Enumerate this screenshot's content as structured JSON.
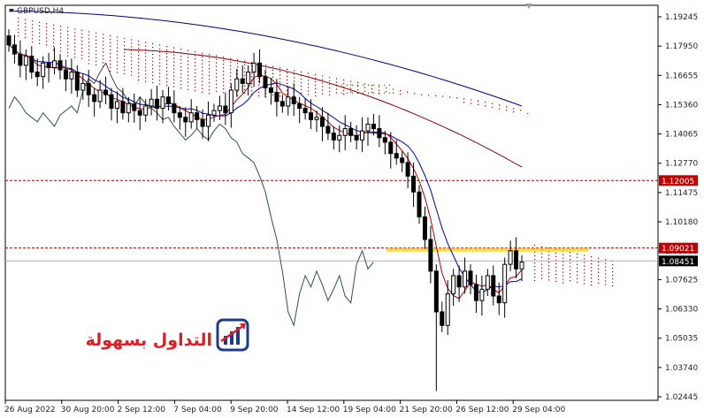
{
  "window": {
    "symbol_title": "GBPUSD,H4"
  },
  "price_axis": {
    "ticks": [
      "1.19245",
      "1.17950",
      "1.16655",
      "1.15360",
      "1.14065",
      "1.12770",
      "1.11475",
      "1.10180",
      "1.08885",
      "1.07625",
      "1.06330",
      "1.05035",
      "1.03740",
      "1.02445"
    ],
    "markers": [
      {
        "label": "1.12005",
        "value": 1.12005,
        "bg": "#c00000",
        "fg": "#ffffff",
        "line": "#a00000",
        "style": "dashed"
      },
      {
        "label": "1.09021",
        "value": 1.09021,
        "bg": "#c00000",
        "fg": "#ffffff",
        "line": "#a00000",
        "style": "dashed"
      },
      {
        "label": "1.08451",
        "value": 1.08451,
        "bg": "#000000",
        "fg": "#ffffff",
        "line": "#b0b0b0",
        "style": "solid"
      }
    ]
  },
  "time_axis": {
    "labels": [
      "26 Aug 2022",
      "30 Aug 20:00",
      "2 Sep 12:00",
      "7 Sep 04:00",
      "9 Sep 20:00",
      "14 Sep 12:00",
      "19 Sep 04:00",
      "21 Sep 20:00",
      "26 Sep 12:00",
      "29 Sep 04:00"
    ]
  },
  "logo": {
    "text": "التداول بسهولة",
    "text_color": "#e31b23",
    "icon_color": "#1f3c88",
    "icon": "bar-chart-arrow-icon"
  },
  "colors": {
    "candle": "#000000",
    "kijun": "#0000b0",
    "tenkan": "#b00000",
    "chikou": "#2f4f4f",
    "long_ma": "#000080",
    "mid_ma": "#8b0000",
    "cloud_bear": "#8b0000",
    "cloud_bull": "#1a6b1a",
    "highlight": "#f5d000"
  },
  "chart_data": {
    "type": "candlestick",
    "symbol": "GBPUSD",
    "timeframe": "H4",
    "ylim": [
      1.02445,
      1.19245
    ],
    "highlight_zone": [
      1.08885,
      1.09021
    ],
    "candles_close": [
      1.18,
      1.176,
      1.171,
      1.175,
      1.168,
      1.166,
      1.172,
      1.17,
      1.173,
      1.169,
      1.165,
      1.168,
      1.16,
      1.163,
      1.158,
      1.155,
      1.16,
      1.158,
      1.152,
      1.155,
      1.15,
      1.154,
      1.151,
      1.149,
      1.153,
      1.156,
      1.152,
      1.157,
      1.154,
      1.15,
      1.148,
      1.146,
      1.15,
      1.147,
      1.144,
      1.149,
      1.151,
      1.153,
      1.15,
      1.16,
      1.165,
      1.163,
      1.168,
      1.172,
      1.166,
      1.161,
      1.159,
      1.155,
      1.153,
      1.157,
      1.154,
      1.152,
      1.15,
      1.147,
      1.148,
      1.144,
      1.141,
      1.138,
      1.14,
      1.143,
      1.14,
      1.138,
      1.142,
      1.145,
      1.143,
      1.139,
      1.137,
      1.132,
      1.13,
      1.128,
      1.122,
      1.115,
      1.104,
      1.094,
      1.08,
      1.062,
      1.056,
      1.07,
      1.078,
      1.073,
      1.08,
      1.074,
      1.067,
      1.072,
      1.078,
      1.069,
      1.066,
      1.083,
      1.089,
      1.081,
      1.084
    ]
  }
}
